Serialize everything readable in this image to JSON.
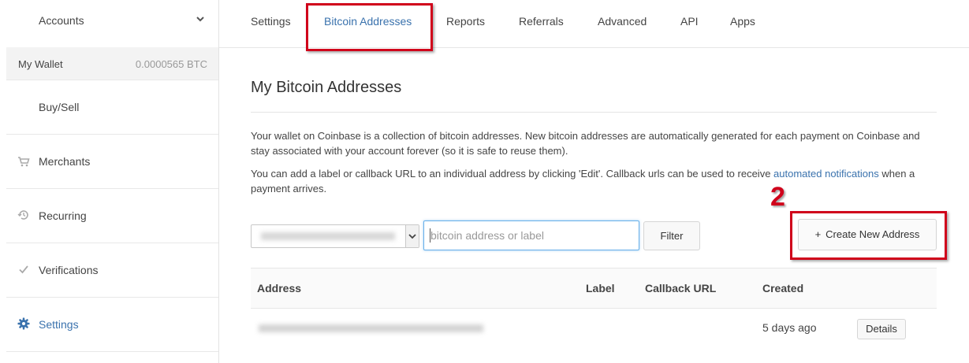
{
  "sidebar": {
    "accounts_label": "Accounts",
    "wallet": {
      "label": "My Wallet",
      "balance": "0.0000565 BTC"
    },
    "items": [
      {
        "label": "Buy/Sell",
        "icon": "none"
      },
      {
        "label": "Merchants",
        "icon": "cart-icon"
      },
      {
        "label": "Recurring",
        "icon": "history-icon"
      },
      {
        "label": "Verifications",
        "icon": "check-icon"
      },
      {
        "label": "Settings",
        "icon": "gear-icon"
      }
    ]
  },
  "tabs": [
    {
      "label": "Settings"
    },
    {
      "label": "Bitcoin Addresses"
    },
    {
      "label": "Reports"
    },
    {
      "label": "Referrals"
    },
    {
      "label": "Advanced"
    },
    {
      "label": "API"
    },
    {
      "label": "Apps"
    }
  ],
  "main": {
    "title": "My Bitcoin Addresses",
    "para1": "Your wallet on Coinbase is a collection of bitcoin addresses. New bitcoin addresses are automatically generated for each payment on Coinbase and stay associated with your account forever (so it is safe to reuse them).",
    "para2_before": "You can add a label or callback URL to an individual address by clicking 'Edit'. Callback urls can be used to receive ",
    "para2_link": "automated notifications",
    "para2_after": " when a payment arrives.",
    "search_placeholder": "bitcoin address or label",
    "filter_label": "Filter",
    "create_label": "Create New Address",
    "create_icon": "plus-icon",
    "annotation_number": "2",
    "table": {
      "columns": [
        "Address",
        "Label",
        "Callback URL",
        "Created"
      ],
      "rows": [
        {
          "created": "5 days ago",
          "details_label": "Details"
        }
      ]
    }
  },
  "colors": {
    "accent": "#3a72ad",
    "annotation_red": "#d0021b"
  }
}
